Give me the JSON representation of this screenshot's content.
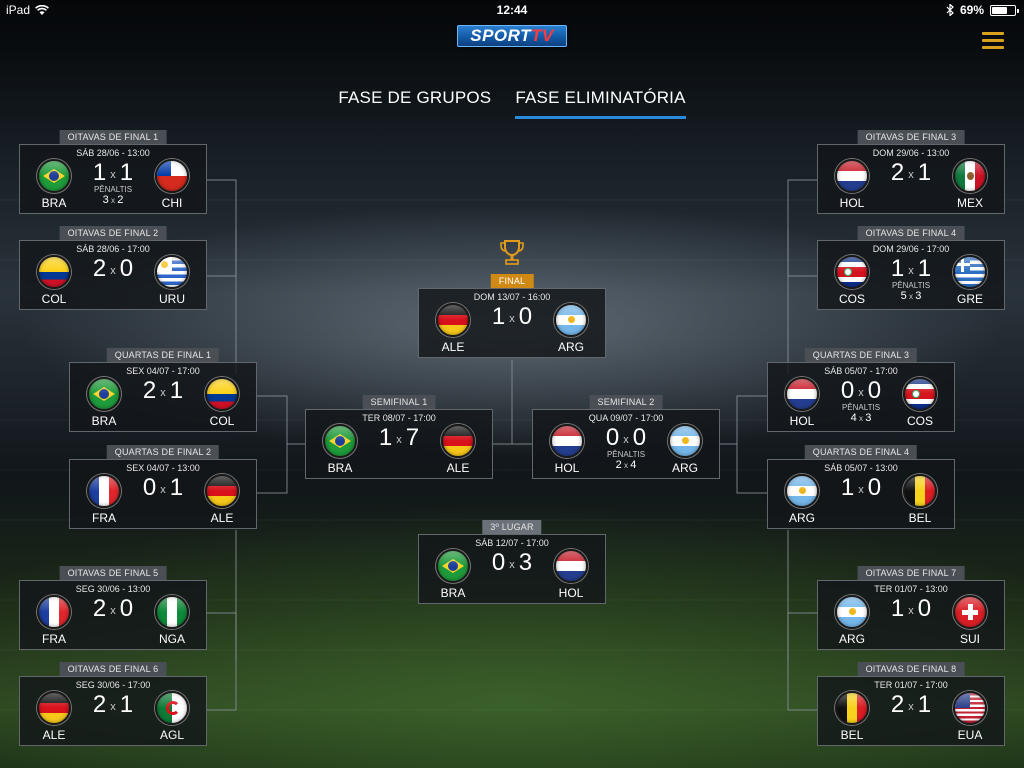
{
  "status_bar": {
    "device": "iPad",
    "time": "12:44",
    "battery": "69%",
    "battery_level": 0.69
  },
  "logo": {
    "sport": "SPORT",
    "tv": "TV"
  },
  "tabs": [
    {
      "label": "FASE DE GRUPOS",
      "active": false
    },
    {
      "label": "FASE ELIMINATÓRIA",
      "active": true
    }
  ],
  "icons": {
    "menu": "hamburger-menu-icon",
    "trophy": "trophy-icon",
    "wifi": "wifi-icon",
    "bluetooth": "bluetooth-icon",
    "battery": "battery-icon"
  },
  "colors": {
    "accent_blue": "#2a8bdc",
    "final_orange": "#d08a14",
    "menu_gold": "#d9a21e"
  },
  "matches": {
    "r16_1": {
      "label": "OITAVAS DE FINAL 1",
      "date": "SÁB 28/06 - 13:00",
      "home": "BRA",
      "away": "CHI",
      "home_score": "1",
      "away_score": "1",
      "x": "x",
      "penalties_label": "PÊNALTIS",
      "pen_home": "3",
      "pen_away": "2"
    },
    "r16_2": {
      "label": "OITAVAS DE FINAL 2",
      "date": "SÁB 28/06 - 17:00",
      "home": "COL",
      "away": "URU",
      "home_score": "2",
      "away_score": "0",
      "x": "x"
    },
    "r16_3": {
      "label": "OITAVAS DE FINAL 3",
      "date": "DOM 29/06 - 13:00",
      "home": "HOL",
      "away": "MEX",
      "home_score": "2",
      "away_score": "1",
      "x": "x"
    },
    "r16_4": {
      "label": "OITAVAS DE FINAL 4",
      "date": "DOM 29/06 - 17:00",
      "home": "COS",
      "away": "GRE",
      "home_score": "1",
      "away_score": "1",
      "x": "x",
      "penalties_label": "PÊNALTIS",
      "pen_home": "5",
      "pen_away": "3"
    },
    "r16_5": {
      "label": "OITAVAS DE FINAL 5",
      "date": "SEG 30/06 - 13:00",
      "home": "FRA",
      "away": "NGA",
      "home_score": "2",
      "away_score": "0",
      "x": "x"
    },
    "r16_6": {
      "label": "OITAVAS DE FINAL 6",
      "date": "SEG 30/06 - 17:00",
      "home": "ALE",
      "away": "AGL",
      "home_score": "2",
      "away_score": "1",
      "x": "x"
    },
    "r16_7": {
      "label": "OITAVAS DE FINAL 7",
      "date": "TER 01/07 - 13:00",
      "home": "ARG",
      "away": "SUI",
      "home_score": "1",
      "away_score": "0",
      "x": "x"
    },
    "r16_8": {
      "label": "OITAVAS DE FINAL 8",
      "date": "TER 01/07 - 17:00",
      "home": "BEL",
      "away": "EUA",
      "home_score": "2",
      "away_score": "1",
      "x": "x"
    },
    "qf_1": {
      "label": "QUARTAS DE FINAL 1",
      "date": "SEX 04/07 - 17:00",
      "home": "BRA",
      "away": "COL",
      "home_score": "2",
      "away_score": "1",
      "x": "x"
    },
    "qf_2": {
      "label": "QUARTAS DE FINAL 2",
      "date": "SEX 04/07 - 13:00",
      "home": "FRA",
      "away": "ALE",
      "home_score": "0",
      "away_score": "1",
      "x": "x"
    },
    "qf_3": {
      "label": "QUARTAS DE FINAL 3",
      "date": "SÁB 05/07 - 17:00",
      "home": "HOL",
      "away": "COS",
      "home_score": "0",
      "away_score": "0",
      "x": "x",
      "penalties_label": "PÊNALTIS",
      "pen_home": "4",
      "pen_away": "3"
    },
    "qf_4": {
      "label": "QUARTAS DE FINAL 4",
      "date": "SÁB 05/07 - 13:00",
      "home": "ARG",
      "away": "BEL",
      "home_score": "1",
      "away_score": "0",
      "x": "x"
    },
    "sf_1": {
      "label": "SEMIFINAL 1",
      "date": "TER 08/07 - 17:00",
      "home": "BRA",
      "away": "ALE",
      "home_score": "1",
      "away_score": "7",
      "x": "x"
    },
    "sf_2": {
      "label": "SEMIFINAL 2",
      "date": "QUA 09/07 - 17:00",
      "home": "HOL",
      "away": "ARG",
      "home_score": "0",
      "away_score": "0",
      "x": "x",
      "penalties_label": "PÊNALTIS",
      "pen_home": "2",
      "pen_away": "4"
    },
    "final": {
      "label": "FINAL",
      "date": "DOM 13/07 - 16:00",
      "home": "ALE",
      "away": "ARG",
      "home_score": "1",
      "away_score": "0",
      "x": "x"
    },
    "third": {
      "label": "3º LUGAR",
      "date": "SÁB 12/07 - 17:00",
      "home": "BRA",
      "away": "HOL",
      "home_score": "0",
      "away_score": "3",
      "x": "x"
    }
  }
}
